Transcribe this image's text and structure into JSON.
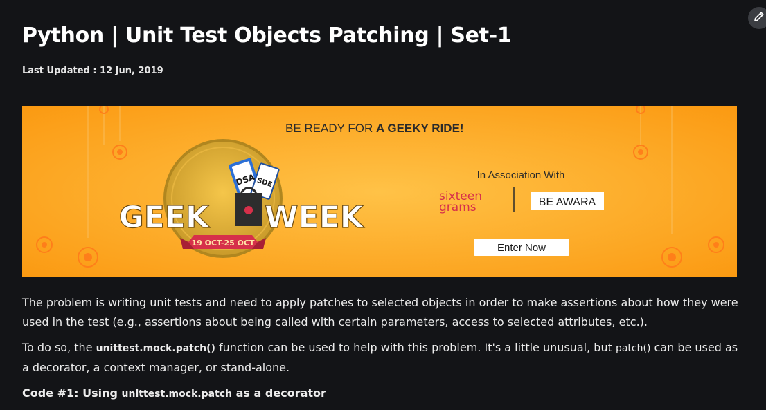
{
  "article": {
    "title": "Python | Unit Test Objects Patching | Set-1",
    "last_updated": "Last Updated : 12 Jun, 2019"
  },
  "banner": {
    "headline_prefix": "BE READY FOR ",
    "headline_bold": "A GEEKY RIDE!",
    "association": "In Association With",
    "sponsor1_line1": "sixteen",
    "sponsor1_line2": "grams",
    "sponsor2": "BE AWARA",
    "cta": "Enter Now",
    "event_left": "GEEK",
    "event_right": "WEEK",
    "dates": "19 OCT-25 OCT",
    "ticket1": "DSA",
    "ticket2": "SDE",
    "colors": {
      "bg": "#fba31c",
      "accent": "#d6304a"
    }
  },
  "body": {
    "p1": "The problem is writing unit tests and need to apply patches to selected objects in order to make assertions about how they were used in the test (e.g., assertions about being called with certain parameters, access to selected attributes, etc.).",
    "p2_a": "To do so, the ",
    "p2_code1": "unittest.mock.patch()",
    "p2_b": " function can be used to help with this problem. It's a little unusual, but ",
    "p2_code2": "patch()",
    "p2_c": " can be used as a decorator, a context manager, or stand-alone.",
    "h_a": "Code #1: Using ",
    "h_code": "unittest.mock.patch",
    "h_b": " as a decorator"
  },
  "icons": {
    "edit": "pencil-icon"
  }
}
